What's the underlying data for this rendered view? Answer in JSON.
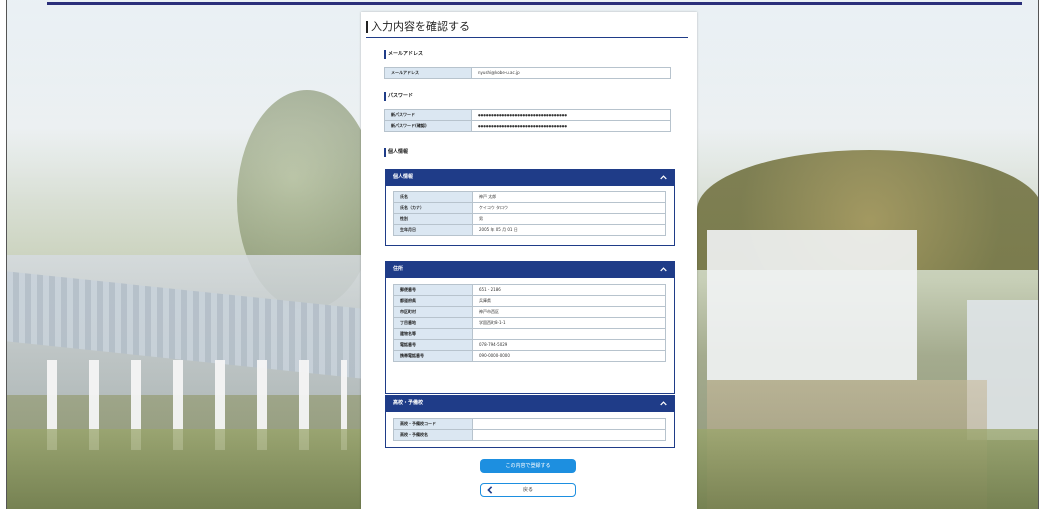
{
  "page": {
    "title": "入力内容を確認する"
  },
  "email_section": {
    "label": "メールアドレス",
    "rows": [
      {
        "label": "メールアドレス",
        "value": "nyushi@kobe-u.ac.jp"
      }
    ]
  },
  "password_section": {
    "label": "パスワード",
    "rows": [
      {
        "label": "新パスワード",
        "value": "●●●●●●●●●●●●●●●●●●●●●●●●●●●●●●●●●●"
      },
      {
        "label": "新パスワード(確認)",
        "value": "●●●●●●●●●●●●●●●●●●●●●●●●●●●●●●●●●●"
      }
    ]
  },
  "personal_label": "個人情報",
  "personal_panel": {
    "header": "個人情報",
    "rows": [
      {
        "label": "氏名",
        "value": "神戸 太郎"
      },
      {
        "label": "氏名（カナ）",
        "value": "ケイコウ タロウ"
      },
      {
        "label": "性別",
        "value": "男"
      },
      {
        "label": "生年月日",
        "value": "2005 年 05 月 01 日"
      }
    ]
  },
  "address_panel": {
    "header": "住所",
    "rows": [
      {
        "label": "郵便番号",
        "value": "651 - 2186"
      },
      {
        "label": "都道府県",
        "value": "兵庫県"
      },
      {
        "label": "市区町村",
        "value": "神戸市西区"
      },
      {
        "label": "丁目番地",
        "value": "学園西町8-1-1"
      },
      {
        "label": "建物名等",
        "value": ""
      },
      {
        "label": "電話番号",
        "value": "078-794-5029"
      },
      {
        "label": "携帯電話番号",
        "value": "090-0000-0000"
      }
    ]
  },
  "school_panel": {
    "header": "高校・予備校",
    "rows": [
      {
        "label": "高校・予備校コード",
        "value": ""
      },
      {
        "label": "高校・予備校名",
        "value": ""
      }
    ]
  },
  "buttons": {
    "register": "この内容で登録する",
    "back": "戻る"
  },
  "icons": {
    "chevron": "chevron-up-icon",
    "back_arrow": "chevron-left-icon"
  },
  "colors": {
    "accent_navy": "#1f3c88",
    "button_blue": "#1d8fe0",
    "header_cell": "#dbe7f2"
  }
}
